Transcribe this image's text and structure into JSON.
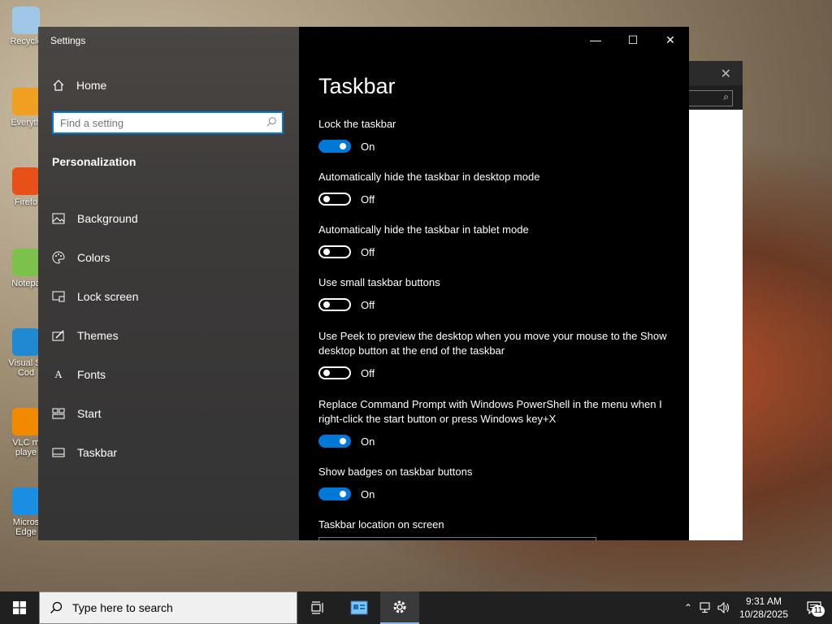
{
  "desktop": {
    "icons": [
      {
        "label": "Recycle",
        "color": "#9ec7e8"
      },
      {
        "label": "Everyth",
        "color": "#f0a020"
      },
      {
        "label": "Firefo",
        "color": "#e8501a"
      },
      {
        "label": "Notepa",
        "color": "#7cc24a"
      },
      {
        "label": "Visual St Cod",
        "color": "#1f8ad2"
      },
      {
        "label": "VLC m playe",
        "color": "#f18a00"
      },
      {
        "label": "Micros Edge",
        "color": "#1a8ee0"
      }
    ]
  },
  "settings": {
    "window_title": "Settings",
    "home_label": "Home",
    "search_placeholder": "Find a setting",
    "section_label": "Personalization",
    "nav_items": [
      {
        "label": "Background",
        "icon": "image-icon"
      },
      {
        "label": "Colors",
        "icon": "palette-icon"
      },
      {
        "label": "Lock screen",
        "icon": "lock-screen-icon"
      },
      {
        "label": "Themes",
        "icon": "themes-icon"
      },
      {
        "label": "Fonts",
        "icon": "fonts-icon"
      },
      {
        "label": "Start",
        "icon": "start-icon"
      },
      {
        "label": "Taskbar",
        "icon": "taskbar-icon"
      }
    ],
    "page_title": "Taskbar",
    "settings_list": [
      {
        "label": "Lock the taskbar",
        "state": "On"
      },
      {
        "label": "Automatically hide the taskbar in desktop mode",
        "state": "Off"
      },
      {
        "label": "Automatically hide the taskbar in tablet mode",
        "state": "Off"
      },
      {
        "label": "Use small taskbar buttons",
        "state": "Off"
      },
      {
        "label": "Use Peek to preview the desktop when you move your mouse to the Show desktop button at the end of the taskbar",
        "state": "Off"
      },
      {
        "label": "Replace Command Prompt with Windows PowerShell in the menu when I right-click the start button or press Windows key+X",
        "state": "On"
      },
      {
        "label": "Show badges on taskbar buttons",
        "state": "On"
      }
    ],
    "location_label": "Taskbar location on screen"
  },
  "taskbar": {
    "search_placeholder": "Type here to search",
    "time": "9:31 AM",
    "date": "10/28/2025",
    "notification_count": "11"
  },
  "colors": {
    "accent": "#0078d7"
  }
}
